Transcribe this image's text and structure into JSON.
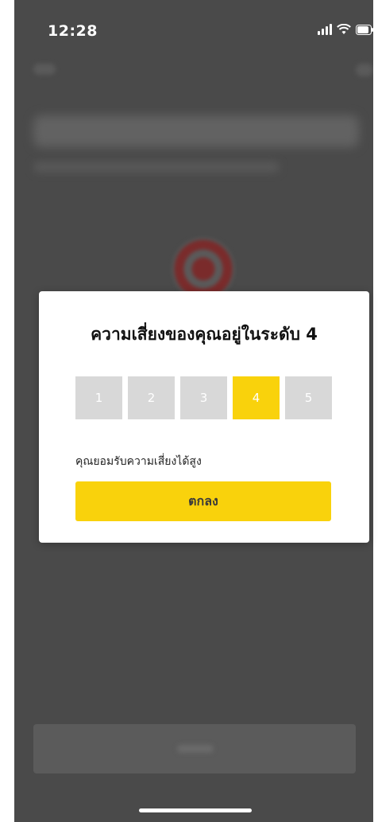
{
  "status_bar": {
    "time": "12:28",
    "icons": [
      "signal-icon",
      "wifi-icon",
      "battery-icon"
    ]
  },
  "modal": {
    "title": "ความเสี่ยงของคุณอยู่ในระดับ 4",
    "levels": [
      "1",
      "2",
      "3",
      "4",
      "5"
    ],
    "selected_level": "4",
    "description": "คุณยอมรับความเสี่ยงได้สูง",
    "ok_label": "ตกลง"
  },
  "colors": {
    "accent": "#f9d20c",
    "inactive_level": "#d8d8d8",
    "overlay_background": "#4a4a4a"
  }
}
